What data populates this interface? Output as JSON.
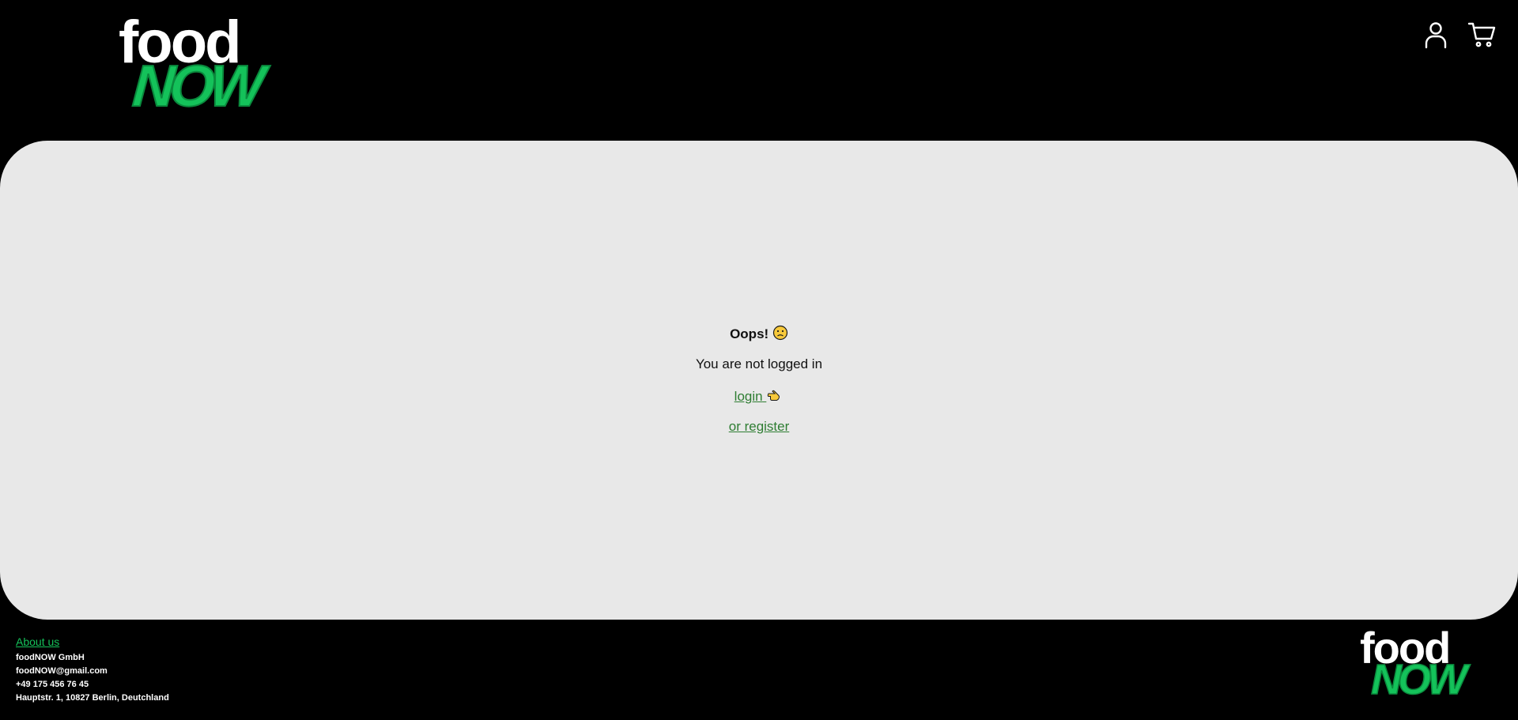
{
  "header": {
    "logo_top": "food",
    "logo_bottom": "NOW",
    "user_icon": "user-icon",
    "cart_icon": "cart-icon"
  },
  "main": {
    "title": "Oops!",
    "title_emoji": "sad-face-emoji",
    "message": "You are not logged in",
    "login_label": "login",
    "login_emoji": "pointing-hand-emoji",
    "register_label": "or register"
  },
  "footer": {
    "about_label": "About us",
    "company": "foodNOW GmbH",
    "email": "foodNOW@gmail.com",
    "phone": "+49 175 456 76 45",
    "address": "Hauptstr. 1, 10827 Berlin, Deutchland",
    "logo_top": "food",
    "logo_bottom": "NOW"
  },
  "colors": {
    "background": "#000000",
    "panel": "#e8e8e8",
    "brand_green": "#14c25a",
    "link_green": "#2e7d32"
  }
}
